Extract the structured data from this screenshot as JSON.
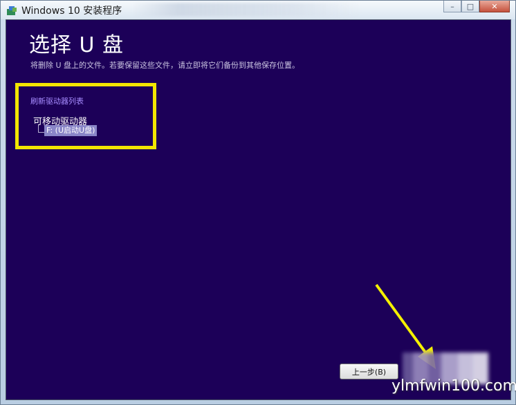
{
  "window": {
    "title": "Windows 10 安装程序",
    "controls": {
      "minimize": "–",
      "maximize": "□",
      "close": "✕"
    }
  },
  "main": {
    "heading": "选择 U 盘",
    "subtext": "将删除 U 盘上的文件。若要保留这些文件，请立即将它们备份到其他保存位置。",
    "refresh_link": "刷新驱动器列表",
    "drive_group": "可移动驱动器",
    "drive_item": "F: (U启动U盘)"
  },
  "footer": {
    "back_label": "上一步(B)"
  },
  "watermark": "ylmfwin100.com",
  "colors": {
    "content_bg": "#1c0058",
    "highlight": "#f2e600",
    "link": "#a78cff",
    "arrow": "#f5f000"
  },
  "icons": {
    "app": "windows-setup-icon",
    "annotation": "yellow-arrow-icon"
  }
}
